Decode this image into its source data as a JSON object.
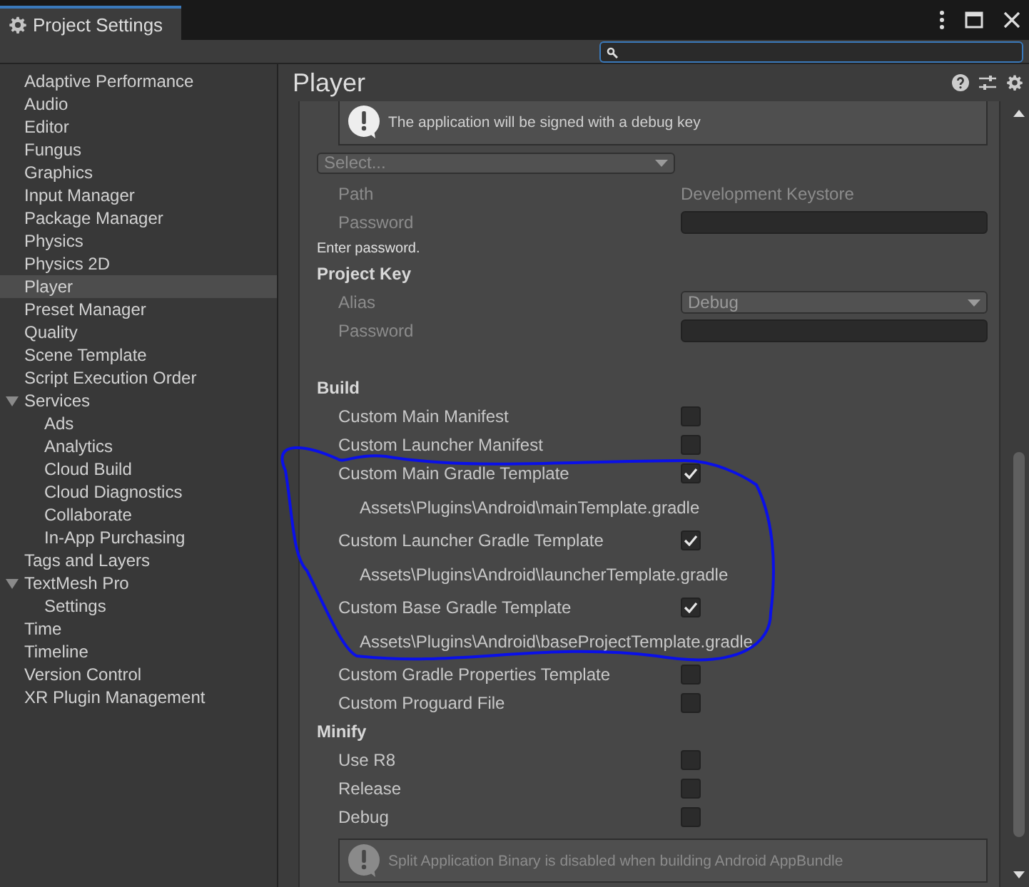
{
  "window": {
    "title": "Project Settings"
  },
  "sidebar": {
    "items": [
      {
        "label": "Adaptive Performance",
        "selected": false
      },
      {
        "label": "Audio",
        "selected": false
      },
      {
        "label": "Editor",
        "selected": false
      },
      {
        "label": "Fungus",
        "selected": false
      },
      {
        "label": "Graphics",
        "selected": false
      },
      {
        "label": "Input Manager",
        "selected": false
      },
      {
        "label": "Package Manager",
        "selected": false
      },
      {
        "label": "Physics",
        "selected": false
      },
      {
        "label": "Physics 2D",
        "selected": false
      },
      {
        "label": "Player",
        "selected": true
      },
      {
        "label": "Preset Manager",
        "selected": false
      },
      {
        "label": "Quality",
        "selected": false
      },
      {
        "label": "Scene Template",
        "selected": false
      },
      {
        "label": "Script Execution Order",
        "selected": false
      },
      {
        "label": "Services",
        "selected": false,
        "expanded": true,
        "children": [
          {
            "label": "Ads",
            "selected": false
          },
          {
            "label": "Analytics",
            "selected": false
          },
          {
            "label": "Cloud Build",
            "selected": false
          },
          {
            "label": "Cloud Diagnostics",
            "selected": false
          },
          {
            "label": "Collaborate",
            "selected": false
          },
          {
            "label": "In-App Purchasing",
            "selected": false
          }
        ]
      },
      {
        "label": "Tags and Layers",
        "selected": false
      },
      {
        "label": "TextMesh Pro",
        "selected": false,
        "expanded": true,
        "children": [
          {
            "label": "Settings",
            "selected": false
          }
        ]
      },
      {
        "label": "Time",
        "selected": false
      },
      {
        "label": "Timeline",
        "selected": false
      },
      {
        "label": "Version Control",
        "selected": false
      },
      {
        "label": "XR Plugin Management",
        "selected": false
      }
    ]
  },
  "panel": {
    "title": "Player",
    "rows": [
      {
        "kind": "helpbox",
        "text": "The application will be signed with a debug key",
        "disabled": false
      },
      {
        "kind": "dropdown",
        "value": "Select..."
      },
      {
        "kind": "text",
        "label": "Path",
        "value": "Development Keystore"
      },
      {
        "kind": "input",
        "label": "Password"
      },
      {
        "kind": "hint",
        "text": "Enter password."
      },
      {
        "kind": "header",
        "text": "Project Key"
      },
      {
        "kind": "select",
        "label": "Alias",
        "value": "Debug"
      },
      {
        "kind": "input",
        "label": "Password"
      },
      {
        "kind": "spacer"
      },
      {
        "kind": "header",
        "text": "Build"
      },
      {
        "kind": "checkbox",
        "label": "Custom Main Manifest",
        "checked": false
      },
      {
        "kind": "checkbox",
        "label": "Custom Launcher Manifest",
        "checked": false
      },
      {
        "kind": "checkbox",
        "label": "Custom Main Gradle Template",
        "checked": true
      },
      {
        "kind": "path",
        "text": "Assets\\Plugins\\Android\\mainTemplate.gradle"
      },
      {
        "kind": "checkbox",
        "label": "Custom Launcher Gradle Template",
        "checked": true
      },
      {
        "kind": "path",
        "text": "Assets\\Plugins\\Android\\launcherTemplate.gradle"
      },
      {
        "kind": "checkbox",
        "label": "Custom Base Gradle Template",
        "checked": true
      },
      {
        "kind": "path",
        "text": "Assets\\Plugins\\Android\\baseProjectTemplate.gradle"
      },
      {
        "kind": "checkbox",
        "label": "Custom Gradle Properties Template",
        "checked": false
      },
      {
        "kind": "checkbox",
        "label": "Custom Proguard File",
        "checked": false
      },
      {
        "kind": "header",
        "text": "Minify"
      },
      {
        "kind": "checkbox",
        "label": "Use R8",
        "checked": false
      },
      {
        "kind": "checkbox",
        "label": "Release",
        "checked": false
      },
      {
        "kind": "checkbox",
        "label": "Debug",
        "checked": false
      },
      {
        "kind": "helpbox",
        "text": "Split Application Binary is disabled when building Android AppBundle",
        "disabled": true
      }
    ]
  }
}
